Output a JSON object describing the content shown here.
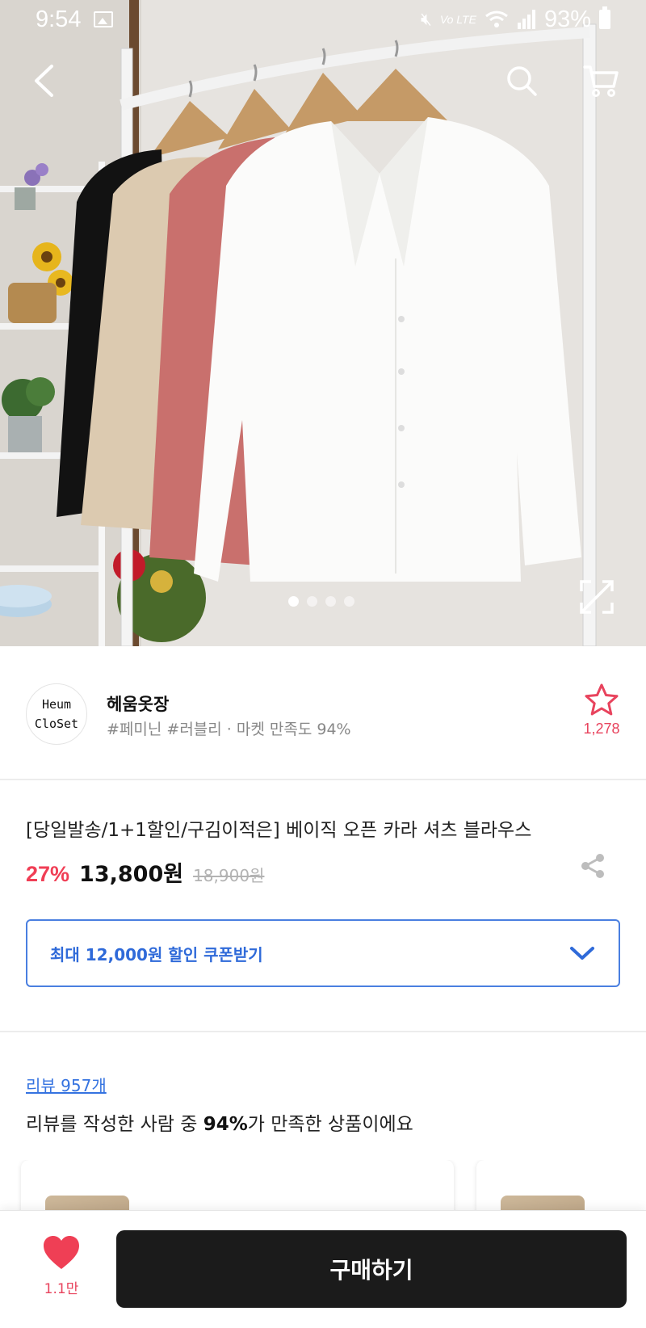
{
  "status_bar": {
    "time": "9:54",
    "network": "Vo LTE",
    "battery": "93%"
  },
  "hero": {
    "image_count": 4,
    "active_index": 0
  },
  "seller": {
    "logo_line1": "Heum",
    "logo_line2": "CloSet",
    "name": "헤움옷장",
    "meta": "#페미닌 #러블리 · 마켓 만족도 94%",
    "favorite_count": "1,278"
  },
  "product": {
    "title": "[당일발송/1+1할인/구김이적은] 베이직 오픈 카라 셔츠 블라우스",
    "discount_rate": "27%",
    "sale_price": "13,800원",
    "original_price": "18,900원",
    "coupon_label": "최대 12,000원 할인 쿠폰받기"
  },
  "review": {
    "count_label": "리뷰 957개",
    "summary_prefix": "리뷰를 작성한 사람 중 ",
    "summary_highlight": "94%",
    "summary_suffix": "가 만족한 상품이에요"
  },
  "bottom_bar": {
    "like_count": "1.1만",
    "buy_label": "구매하기"
  },
  "colors": {
    "accent_red": "#f03e55",
    "coupon_blue": "#2f6ad9",
    "buy_button": "#1b1b1b"
  },
  "icons": [
    "back-arrow-icon",
    "search-icon",
    "cart-icon",
    "fullscreen-icon",
    "star-icon",
    "share-icon",
    "chevron-down-icon",
    "heart-icon"
  ]
}
